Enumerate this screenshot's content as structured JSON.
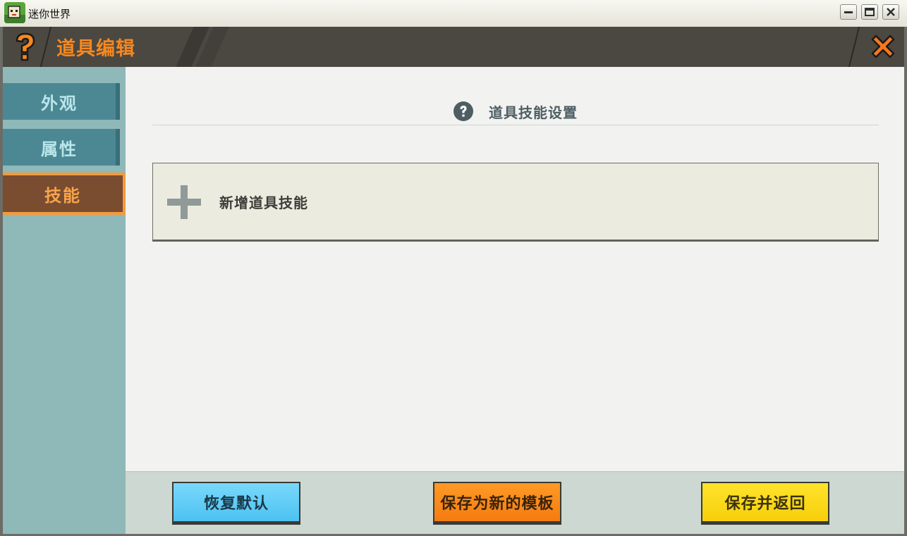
{
  "window": {
    "title": "迷你世界",
    "icon": "mini-world-app-icon",
    "controls": [
      "minimize",
      "maximize",
      "close"
    ]
  },
  "header": {
    "title": "道具编辑",
    "help_icon": "question-mark-icon",
    "close_icon": "close-x-icon"
  },
  "sidebar": {
    "tabs": [
      {
        "label": "外观",
        "active": false
      },
      {
        "label": "属性",
        "active": false
      },
      {
        "label": "技能",
        "active": true
      }
    ]
  },
  "main": {
    "section_title": "道具技能设置",
    "section_icon": "help-circle-icon",
    "add_skill_label": "新增道具技能",
    "add_icon": "plus-icon"
  },
  "footer": {
    "restore_label": "恢复默认",
    "save_template_label": "保存为新的模板",
    "save_return_label": "保存并返回"
  },
  "colors": {
    "accent_orange": "#f6881f",
    "sidebar_bg": "#8fb8b9",
    "tab_bg": "#4c8894",
    "active_tab_bg": "#7a4c30",
    "btn_blue": "#5cc9f5",
    "btn_orange": "#f7861a",
    "btn_yellow": "#fbd91a"
  }
}
